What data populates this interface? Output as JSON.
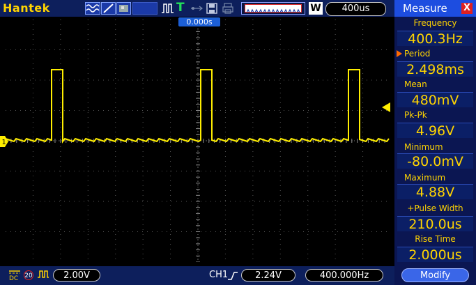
{
  "app": {
    "brand": "Hantek"
  },
  "toolbar": {
    "timebase": "400us",
    "window_label": "W"
  },
  "screen": {
    "trigger_position": "0.000s",
    "ch1_marker": "1"
  },
  "measure": {
    "title": "Measure",
    "close": "X",
    "items": [
      {
        "label": "Frequency",
        "value": "400.3Hz"
      },
      {
        "label": "Period",
        "value": "2.498ms"
      },
      {
        "label": "Mean",
        "value": "480mV"
      },
      {
        "label": "Pk-Pk",
        "value": "4.96V"
      },
      {
        "label": "Minimum",
        "value": "-80.0mV"
      },
      {
        "label": "Maximum",
        "value": "4.88V"
      },
      {
        "label": "+Pulse Width",
        "value": "210.0us"
      },
      {
        "label": "Rise Time",
        "value": "2.000us"
      }
    ],
    "modify_label": "Modify"
  },
  "status": {
    "coupling": "DC",
    "bw_limit": "20",
    "volts_div": "2.00V",
    "trigger_channel": "CH1",
    "trigger_level": "2.24V",
    "trigger_frequency": "400.000Hz"
  },
  "colors": {
    "trace": "#ffee00",
    "bar_bg": "#0d1f5c",
    "accent": "#1d4de0",
    "label_yellow": "#ffd400"
  }
}
